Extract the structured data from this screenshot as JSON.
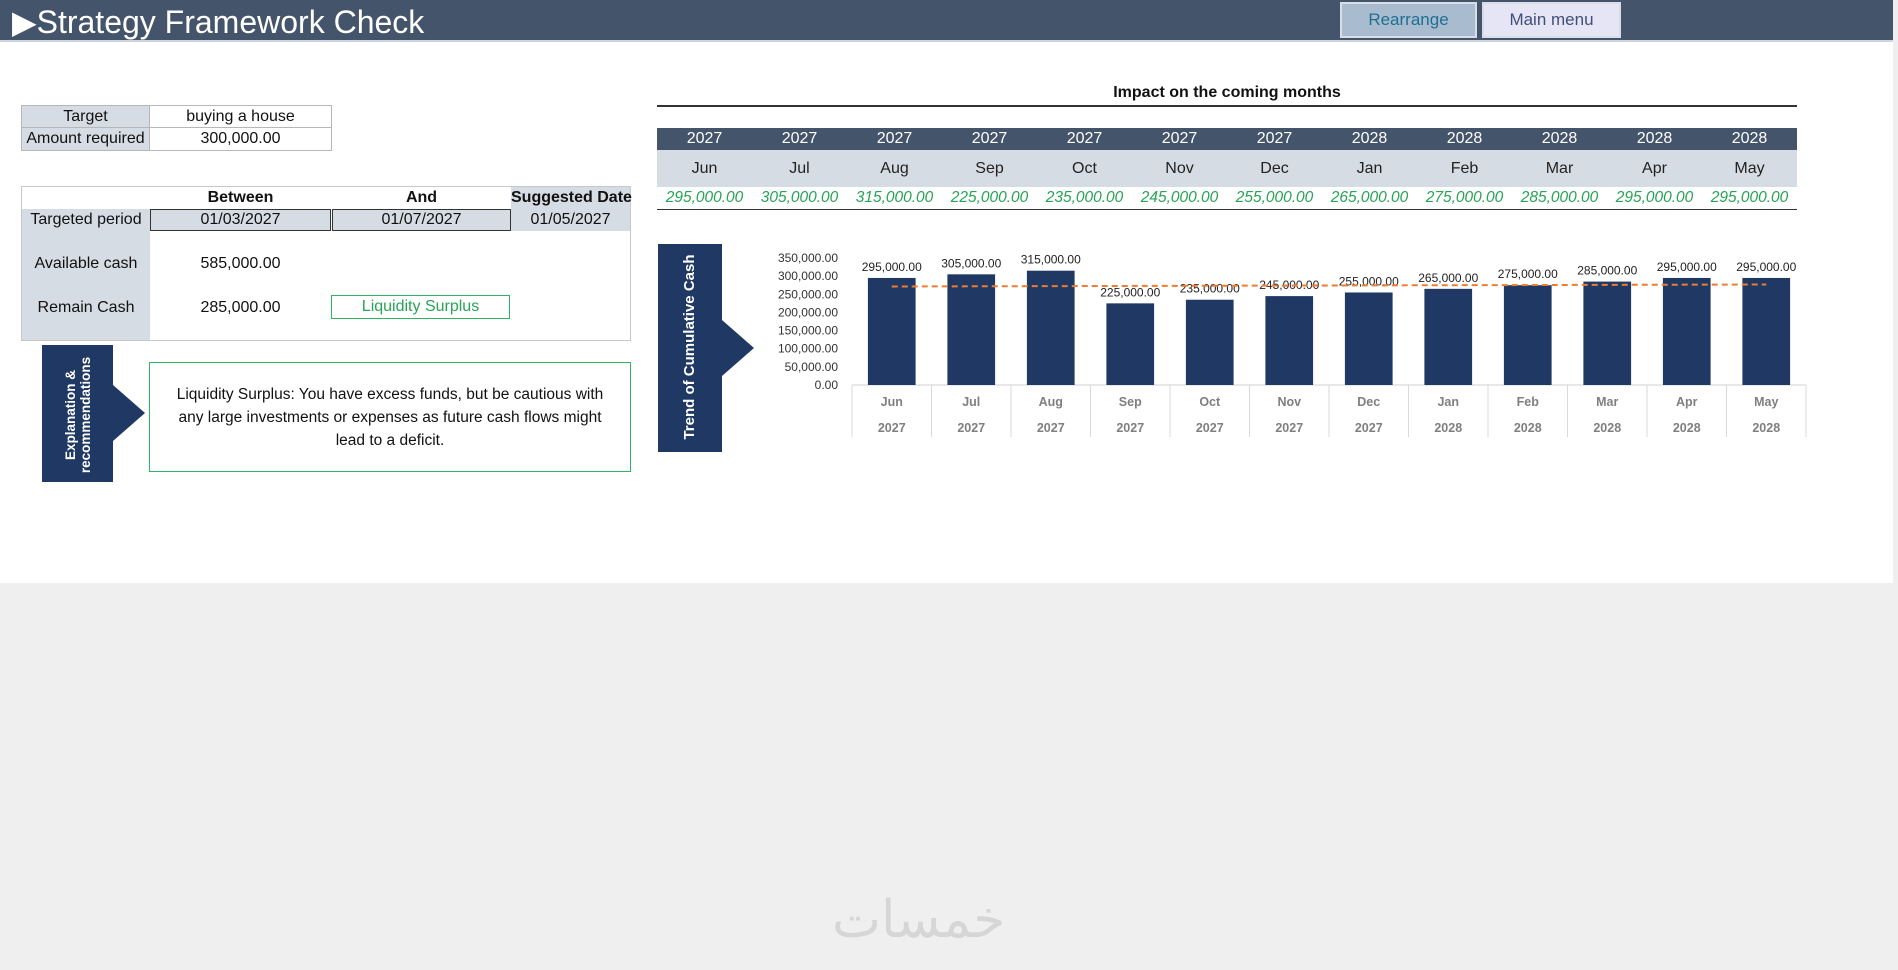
{
  "header": {
    "title": "▶Strategy Framework Check",
    "rearrange_label": "Rearrange",
    "main_menu_label": "Main menu"
  },
  "target": {
    "target_label": "Target",
    "target_value": "buying a house",
    "amount_label": "Amount required",
    "amount_value": "300,000.00"
  },
  "period": {
    "between_header": "Between",
    "and_header": "And",
    "suggested_header": "Suggested Date",
    "targeted_label": "Targeted period",
    "between_value": "01/03/2027",
    "and_value": "01/07/2027",
    "suggested_value": "01/05/2027",
    "available_label": "Available cash",
    "available_value": "585,000.00",
    "remain_label": "Remain Cash",
    "remain_value": "285,000.00",
    "status": "Liquidity Surplus",
    "status_color": "#27a455"
  },
  "explanation": {
    "tag_line1": "Explanation &",
    "tag_line2": "recommendations",
    "text": "Liquidity Surplus: You have excess funds, but be cautious with any large investments or expenses as future cash flows might lead to a deficit."
  },
  "impact": {
    "title": "Impact on the coming months",
    "years": [
      "2027",
      "2027",
      "2027",
      "2027",
      "2027",
      "2027",
      "2027",
      "2028",
      "2028",
      "2028",
      "2028",
      "2028"
    ],
    "months": [
      "Jun",
      "Jul",
      "Aug",
      "Sep",
      "Oct",
      "Nov",
      "Dec",
      "Jan",
      "Feb",
      "Mar",
      "Apr",
      "May"
    ],
    "values": [
      "295,000.00",
      "305,000.00",
      "315,000.00",
      "225,000.00",
      "235,000.00",
      "245,000.00",
      "255,000.00",
      "265,000.00",
      "275,000.00",
      "285,000.00",
      "295,000.00",
      "295,000.00"
    ]
  },
  "chart_tag": "Trend of Cumulative Cash",
  "chart_data": {
    "type": "bar",
    "title": "",
    "categories": [
      "Jun",
      "Jul",
      "Aug",
      "Sep",
      "Oct",
      "Nov",
      "Dec",
      "Jan",
      "Feb",
      "Mar",
      "Apr",
      "May"
    ],
    "category_years": [
      "2027",
      "2027",
      "2027",
      "2027",
      "2027",
      "2027",
      "2027",
      "2028",
      "2028",
      "2028",
      "2028",
      "2028"
    ],
    "values": [
      295000,
      305000,
      315000,
      225000,
      235000,
      245000,
      255000,
      265000,
      275000,
      285000,
      295000,
      295000
    ],
    "data_labels": [
      "295,000.00",
      "305,000.00",
      "315,000.00",
      "225,000.00",
      "235,000.00",
      "245,000.00",
      "255,000.00",
      "265,000.00",
      "275,000.00",
      "285,000.00",
      "295,000.00",
      "295,000.00"
    ],
    "trendline": [
      271500,
      272000,
      272500,
      273000,
      273500,
      274000,
      274500,
      275000,
      275500,
      276000,
      276500,
      277000
    ],
    "ylim": [
      0,
      350000
    ],
    "yticks": [
      0,
      50000,
      100000,
      150000,
      200000,
      250000,
      300000,
      350000
    ],
    "ytick_labels": [
      "0.00",
      "50,000.00",
      "100,000.00",
      "150,000.00",
      "200,000.00",
      "250,000.00",
      "300,000.00",
      "350,000.00"
    ],
    "bar_color": "#203864",
    "trend_color": "#ed7d31",
    "grid": false,
    "legend": "none"
  },
  "watermark": "خمسات"
}
